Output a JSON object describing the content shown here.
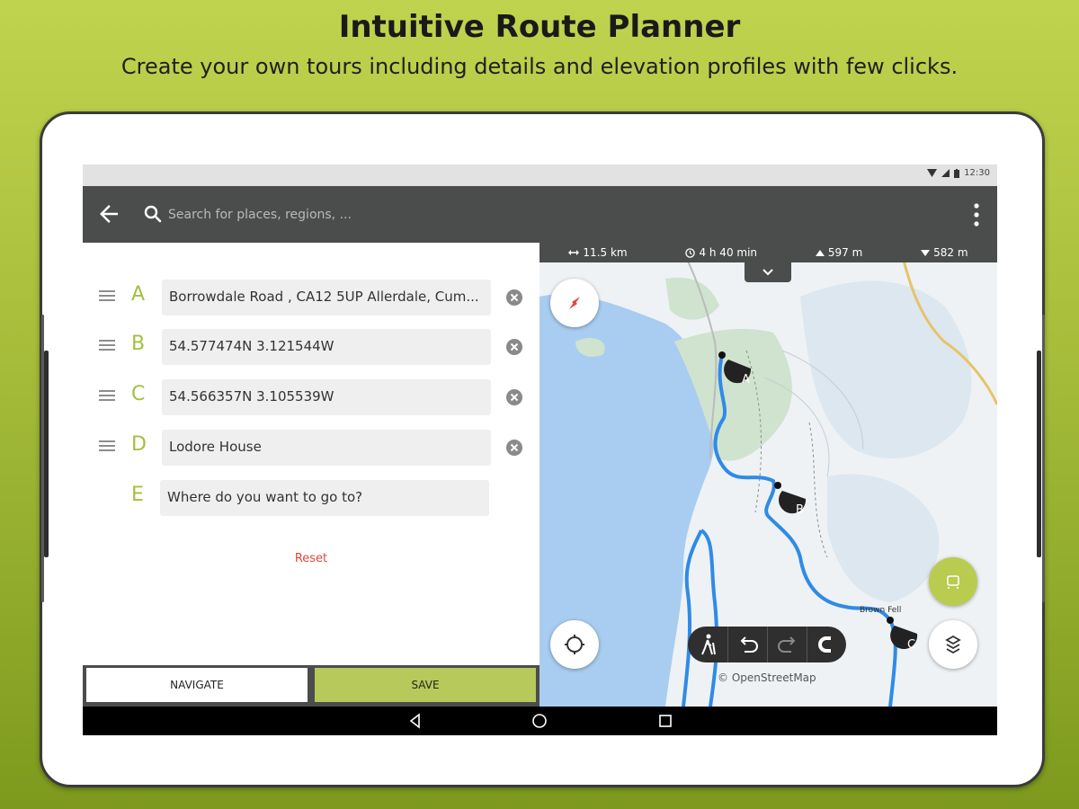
{
  "promo": {
    "title": "Intuitive Route Planner",
    "subtitle": "Create your own tours including details and elevation profiles with few clicks."
  },
  "status": {
    "time": "12:30"
  },
  "appbar": {
    "search_placeholder": "Search for places, regions, ..."
  },
  "waypoints": [
    {
      "letter": "A",
      "value": "Borrowdale Road , CA12 5UP Allerdale, Cum..."
    },
    {
      "letter": "B",
      "value": "54.577474N 3.121544W"
    },
    {
      "letter": "C",
      "value": "54.566357N 3.105539W"
    },
    {
      "letter": "D",
      "value": "Lodore House"
    },
    {
      "letter": "E",
      "value": "Where do you want to go to?"
    }
  ],
  "reset_label": "Reset",
  "buttons": {
    "navigate": "NAVIGATE",
    "save": "SAVE"
  },
  "route_stats": {
    "distance": "11.5 km",
    "duration": "4 h 40 min",
    "ascent": "597 m",
    "descent": "582 m"
  },
  "map": {
    "credit": "© OpenStreetMap",
    "markers": [
      "A",
      "B",
      "C"
    ],
    "place_label": "Brown Fell",
    "route_color": "#2f8be6",
    "water_color": "#a8cdf0"
  },
  "colors": {
    "accent": "#a3c041",
    "appbar": "#4b4d4c",
    "reset": "#e0463c"
  }
}
